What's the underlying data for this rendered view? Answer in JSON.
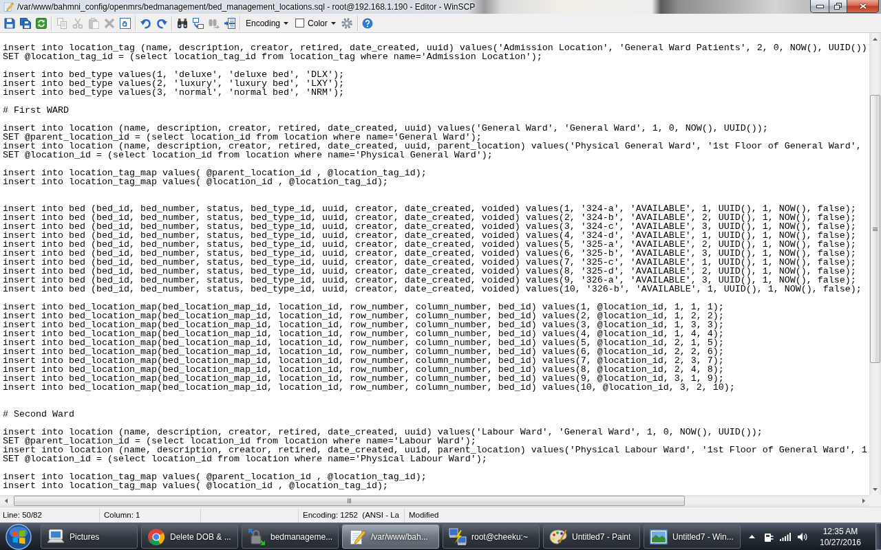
{
  "window": {
    "title": "/var/www/bahmni_config/openmrs/bedmanagement/bed_management_locations.sql - root@192.168.1.190 - Editor - WinSCP"
  },
  "toolbar": {
    "groups": [
      {
        "items": [
          {
            "kind": "button",
            "disabled": false
          },
          {
            "kind": "button",
            "disabled": false
          },
          {
            "kind": "button",
            "disabled": false
          }
        ]
      },
      {
        "items": [
          {
            "kind": "button",
            "disabled": true
          },
          {
            "kind": "button",
            "disabled": true
          },
          {
            "kind": "button",
            "disabled": true
          },
          {
            "kind": "button",
            "disabled": true
          },
          {
            "kind": "button",
            "disabled": false
          }
        ]
      },
      {
        "items": [
          {
            "kind": "button",
            "disabled": false
          },
          {
            "kind": "button",
            "disabled": false
          }
        ]
      },
      {
        "items": [
          {
            "kind": "button",
            "disabled": false
          },
          {
            "kind": "button",
            "disabled": false
          },
          {
            "kind": "button",
            "disabled": true
          },
          {
            "kind": "button",
            "disabled": false
          }
        ]
      },
      {
        "items": [
          {
            "kind": "dropdown",
            "label": "Encoding"
          },
          {
            "kind": "swatch_dropdown",
            "label": "Color"
          },
          {
            "kind": "button",
            "disabled": false
          }
        ]
      },
      {
        "items": [
          {
            "kind": "button",
            "disabled": false
          }
        ]
      }
    ]
  },
  "editor": {
    "lines": [
      {
        "kind": "blank"
      },
      {
        "kind": "code",
        "text": "insert into location_tag (name, description, creator, retired, date_created, uuid) values('Admission Location', 'General Ward Patients', 2, 0, NOW(), UUID())"
      },
      {
        "kind": "code",
        "text": "SET @location_tag_id = (select location_tag_id from location_tag where name='Admission Location');"
      },
      {
        "kind": "blank"
      },
      {
        "kind": "code",
        "text": "insert into bed_type values(1, 'deluxe', 'deluxe bed', 'DLX');"
      },
      {
        "kind": "code",
        "text": "insert into bed_type values(2, 'luxury', 'luxury bed', 'LXY');"
      },
      {
        "kind": "code",
        "text": "insert into bed_type values(3, 'normal', 'normal bed', 'NRM');"
      },
      {
        "kind": "blank"
      },
      {
        "kind": "code",
        "text": "# First WARD"
      },
      {
        "kind": "blank"
      },
      {
        "kind": "code",
        "text": "insert into location (name, description, creator, retired, date_created, uuid) values('General Ward', 'General Ward', 1, 0, NOW(), UUID());"
      },
      {
        "kind": "code",
        "text": "SET @parent_location_id = (select location_id from location where name='General Ward');"
      },
      {
        "kind": "code",
        "text": "insert into location (name, description, creator, retired, date_created, uuid, parent_location) values('Physical General Ward', '1st Floor of General Ward',"
      },
      {
        "kind": "code",
        "text": "SET @location_id = (select location_id from location where name='Physical General Ward');"
      },
      {
        "kind": "blank"
      },
      {
        "kind": "code",
        "text": "insert into location_tag_map values( @parent_location_id , @location_tag_id);"
      },
      {
        "kind": "code",
        "text": "insert into location_tag_map values( @location_id , @location_tag_id);"
      },
      {
        "kind": "blank"
      },
      {
        "kind": "blank"
      },
      {
        "kind": "code",
        "text": "insert into bed (bed_id, bed_number, status, bed_type_id, uuid, creator, date_created, voided) values(1, '324-a', 'AVAILABLE', 1, UUID(), 1, NOW(), false);"
      },
      {
        "kind": "code",
        "text": "insert into bed (bed_id, bed_number, status, bed_type_id, uuid, creator, date_created, voided) values(2, '324-b', 'AVAILABLE', 2, UUID(), 1, NOW(), false);"
      },
      {
        "kind": "code",
        "text": "insert into bed (bed_id, bed_number, status, bed_type_id, uuid, creator, date_created, voided) values(3, '324-c', 'AVAILABLE', 3, UUID(), 1, NOW(), false);"
      },
      {
        "kind": "code",
        "text": "insert into bed (bed_id, bed_number, status, bed_type_id, uuid, creator, date_created, voided) values(4, '324-d', 'AVAILABLE', 1, UUID(), 1, NOW(), false);"
      },
      {
        "kind": "code",
        "text": "insert into bed (bed_id, bed_number, status, bed_type_id, uuid, creator, date_created, voided) values(5, '325-a', 'AVAILABLE', 2, UUID(), 1, NOW(), false);"
      },
      {
        "kind": "code",
        "text": "insert into bed (bed_id, bed_number, status, bed_type_id, uuid, creator, date_created, voided) values(6, '325-b', 'AVAILABLE', 3, UUID(), 1, NOW(), false);"
      },
      {
        "kind": "code",
        "text": "insert into bed (bed_id, bed_number, status, bed_type_id, uuid, creator, date_created, voided) values(7, '325-c', 'AVAILABLE', 1, UUID(), 1, NOW(), false);"
      },
      {
        "kind": "code",
        "text": "insert into bed (bed_id, bed_number, status, bed_type_id, uuid, creator, date_created, voided) values(8, '325-d', 'AVAILABLE', 2, UUID(), 1, NOW(), false);"
      },
      {
        "kind": "code",
        "text": "insert into bed (bed_id, bed_number, status, bed_type_id, uuid, creator, date_created, voided) values(9, '326-a', 'AVAILABLE', 3, UUID(), 1, NOW(), false);"
      },
      {
        "kind": "code",
        "text": "insert into bed (bed_id, bed_number, status, bed_type_id, uuid, creator, date_created, voided) values(10, '326-b', 'AVAILABLE', 1, UUID(), 1, NOW(), false);"
      },
      {
        "kind": "blank"
      },
      {
        "kind": "code",
        "text": "insert into bed_location_map(bed_location_map_id, location_id, row_number, column_number, bed_id) values(1, @location_id, 1, 1, 1);"
      },
      {
        "kind": "code",
        "text": "insert into bed_location_map(bed_location_map_id, location_id, row_number, column_number, bed_id) values(2, @location_id, 1, 2, 2);"
      },
      {
        "kind": "code",
        "text": "insert into bed_location_map(bed_location_map_id, location_id, row_number, column_number, bed_id) values(3, @location_id, 1, 3, 3);"
      },
      {
        "kind": "code",
        "text": "insert into bed_location_map(bed_location_map_id, location_id, row_number, column_number, bed_id) values(4, @location_id, 1, 4, 4);"
      },
      {
        "kind": "code",
        "text": "insert into bed_location_map(bed_location_map_id, location_id, row_number, column_number, bed_id) values(5, @location_id, 2, 1, 5);"
      },
      {
        "kind": "code",
        "text": "insert into bed_location_map(bed_location_map_id, location_id, row_number, column_number, bed_id) values(6, @location_id, 2, 2, 6);"
      },
      {
        "kind": "code",
        "text": "insert into bed_location_map(bed_location_map_id, location_id, row_number, column_number, bed_id) values(7, @location_id, 2, 3, 7);"
      },
      {
        "kind": "code",
        "text": "insert into bed_location_map(bed_location_map_id, location_id, row_number, column_number, bed_id) values(8, @location_id, 2, 4, 8);"
      },
      {
        "kind": "code",
        "text": "insert into bed_location_map(bed_location_map_id, location_id, row_number, column_number, bed_id) values(9, @location_id, 3, 1, 9);"
      },
      {
        "kind": "code",
        "text": "insert into bed_location_map(bed_location_map_id, location_id, row_number, column_number, bed_id) values(10, @location_id, 3, 2, 10);"
      },
      {
        "kind": "blank"
      },
      {
        "kind": "blank"
      },
      {
        "kind": "code",
        "text": "# Second Ward"
      },
      {
        "kind": "blank"
      },
      {
        "kind": "code",
        "text": "insert into location (name, description, creator, retired, date_created, uuid) values('Labour Ward', 'General Ward', 1, 0, NOW(), UUID());"
      },
      {
        "kind": "code",
        "text": "SET @parent_location_id = (select location_id from location where name='Labour Ward');"
      },
      {
        "kind": "code",
        "text": "insert into location (name, description, creator, retired, date_created, uuid, parent_location) values('Physical Labour Ward', '1st Floor of General Ward', 1"
      },
      {
        "kind": "code",
        "text": "SET @location_id = (select location_id from location where name='Physical Labour Ward');"
      },
      {
        "kind": "blank"
      },
      {
        "kind": "code",
        "text": "insert into location_tag_map values( @parent_location_id , @location_tag_id);"
      },
      {
        "kind": "code",
        "text": "insert into location_tag_map values( @location_id , @location_tag_id);"
      }
    ]
  },
  "status_bar": {
    "panels": [
      {
        "kind": "text",
        "text": "Line: 50/82"
      },
      {
        "kind": "text",
        "text": "Column: 1"
      },
      {
        "kind": "blank"
      },
      {
        "kind": "text",
        "text": "Encoding: 1252  (ANSI - La"
      },
      {
        "kind": "text",
        "text": "Modified"
      }
    ]
  },
  "taskbar": {
    "buttons": [
      {
        "label": "Pictures",
        "selected": false
      },
      {
        "label": "Delete DOB & ...",
        "selected": false
      },
      {
        "label": "bedmanageme...",
        "selected": false
      },
      {
        "label": "/var/www/bah...",
        "selected": true
      },
      {
        "label": "root@cheeku:~",
        "selected": false
      },
      {
        "label": "Untitled7 - Paint",
        "selected": false
      },
      {
        "label": "Untitled7 - Win...",
        "selected": false
      }
    ],
    "clock": {
      "time": "12:35 AM",
      "date": "10/27/2016"
    }
  }
}
